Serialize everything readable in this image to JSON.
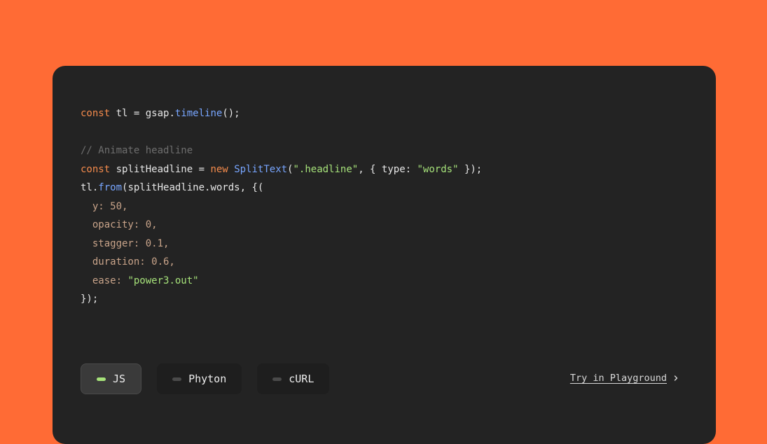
{
  "code": {
    "lines": [
      [
        {
          "t": "const",
          "k": "kw"
        },
        {
          "t": " tl = gsap.",
          "k": "plain"
        },
        {
          "t": "timeline",
          "k": "fn"
        },
        {
          "t": "();",
          "k": "plain"
        }
      ],
      [],
      [
        {
          "t": "// Animate headline",
          "k": "cmt"
        }
      ],
      [
        {
          "t": "const",
          "k": "kw"
        },
        {
          "t": " splitHeadline = ",
          "k": "plain"
        },
        {
          "t": "new",
          "k": "kw"
        },
        {
          "t": " ",
          "k": "plain"
        },
        {
          "t": "SplitText",
          "k": "fn"
        },
        {
          "t": "(",
          "k": "plain"
        },
        {
          "t": "\".headline\"",
          "k": "str"
        },
        {
          "t": ", { type: ",
          "k": "plain"
        },
        {
          "t": "\"words\"",
          "k": "str"
        },
        {
          "t": " });",
          "k": "plain"
        }
      ],
      [
        {
          "t": "tl.",
          "k": "plain"
        },
        {
          "t": "from",
          "k": "fn"
        },
        {
          "t": "(splitHeadline.words, {(",
          "k": "plain"
        }
      ],
      [
        {
          "t": "  y: 50,",
          "k": "prop"
        }
      ],
      [
        {
          "t": "  opacity: 0,",
          "k": "prop"
        }
      ],
      [
        {
          "t": "  stagger: 0.1,",
          "k": "prop"
        }
      ],
      [
        {
          "t": "  duration: 0.6,",
          "k": "prop"
        }
      ],
      [
        {
          "t": "  ease: ",
          "k": "prop"
        },
        {
          "t": "\"power3.out\"",
          "k": "str"
        }
      ],
      [
        {
          "t": "});",
          "k": "plain"
        }
      ]
    ]
  },
  "tabs": [
    {
      "label": "JS",
      "active": true
    },
    {
      "label": "Phyton",
      "active": false
    },
    {
      "label": "cURL",
      "active": false
    }
  ],
  "playground": {
    "label": "Try in Playground",
    "icon": "chevron-right-icon"
  },
  "colors": {
    "background": "#FF6B35",
    "card": "#232323",
    "keyword": "#F58B4C",
    "function": "#78A6FF",
    "string": "#A6E27A",
    "comment": "#6E6E6E",
    "property": "#C9A48A"
  }
}
